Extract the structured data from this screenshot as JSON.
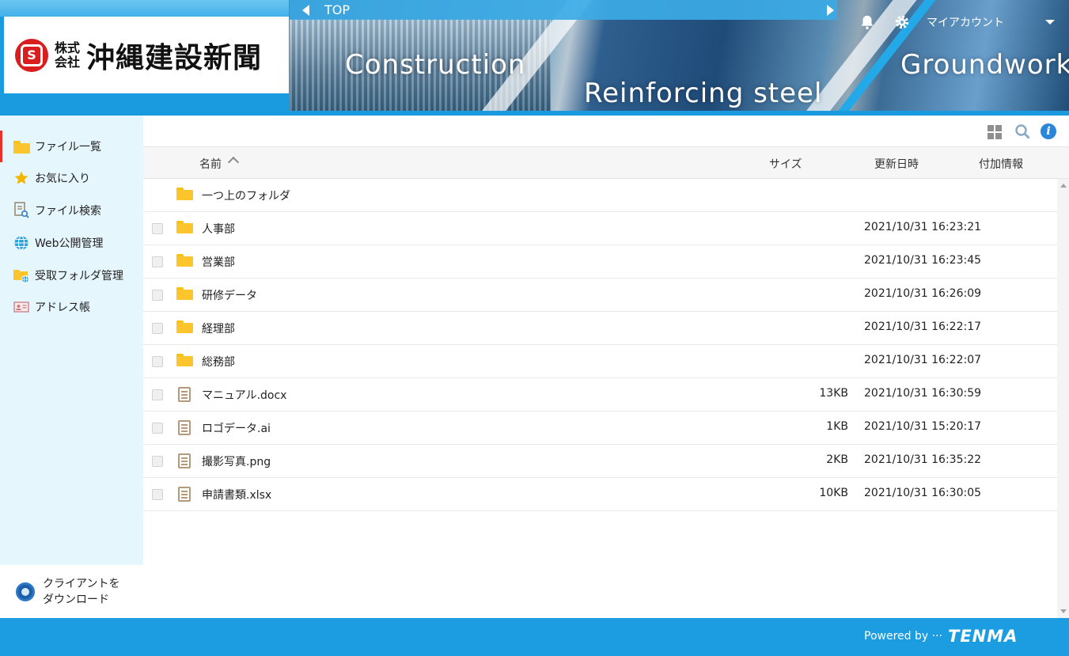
{
  "header": {
    "company_prefix_1": "株式",
    "company_prefix_2": "会社",
    "company_name": "沖縄建設新聞",
    "logo_mark": "S",
    "banner_words": [
      "Construction",
      "Reinforcing steel",
      "Groundwork"
    ],
    "nav_title": "TOP",
    "account_label": "マイアカウント"
  },
  "sidebar": {
    "items": [
      {
        "label": "ファイル一覧",
        "icon": "folder-icon"
      },
      {
        "label": "お気に入り",
        "icon": "star-icon"
      },
      {
        "label": "ファイル検索",
        "icon": "file-search-icon"
      },
      {
        "label": "Web公開管理",
        "icon": "globe-icon"
      },
      {
        "label": "受取フォルダ管理",
        "icon": "shared-folder-icon"
      },
      {
        "label": "アドレス帳",
        "icon": "address-card-icon"
      }
    ],
    "download_line1": "クライアントを",
    "download_line2": "ダウンロード"
  },
  "columns": {
    "name": "名前",
    "size": "サイズ",
    "date": "更新日時",
    "extra": "付加情報"
  },
  "files": [
    {
      "name": "一つ上のフォルダ",
      "type": "folder",
      "size": "",
      "date": ""
    },
    {
      "name": "人事部",
      "type": "folder",
      "size": "",
      "date": "2021/10/31 16:23:21"
    },
    {
      "name": "営業部",
      "type": "folder",
      "size": "",
      "date": "2021/10/31 16:23:45"
    },
    {
      "name": "研修データ",
      "type": "folder",
      "size": "",
      "date": "2021/10/31 16:26:09"
    },
    {
      "name": "経理部",
      "type": "folder",
      "size": "",
      "date": "2021/10/31 16:22:17"
    },
    {
      "name": "総務部",
      "type": "folder",
      "size": "",
      "date": "2021/10/31 16:22:07"
    },
    {
      "name": "マニュアル.docx",
      "type": "file",
      "size": "13KB",
      "date": "2021/10/31 16:30:59"
    },
    {
      "name": "ロゴデータ.ai",
      "type": "file",
      "size": "1KB",
      "date": "2021/10/31 15:20:17"
    },
    {
      "name": "撮影写真.png",
      "type": "file",
      "size": "2KB",
      "date": "2021/10/31 16:35:22"
    },
    {
      "name": "申請書類.xlsx",
      "type": "file",
      "size": "10KB",
      "date": "2021/10/31 16:30:05"
    }
  ],
  "footer": {
    "powered": "Powered by ···",
    "brand": "TENMA"
  },
  "colors": {
    "accent": "#1c9de1",
    "sidebar_bg": "#e6f6fd",
    "active_marker": "#e8312b",
    "folder": "#fbc52b"
  }
}
